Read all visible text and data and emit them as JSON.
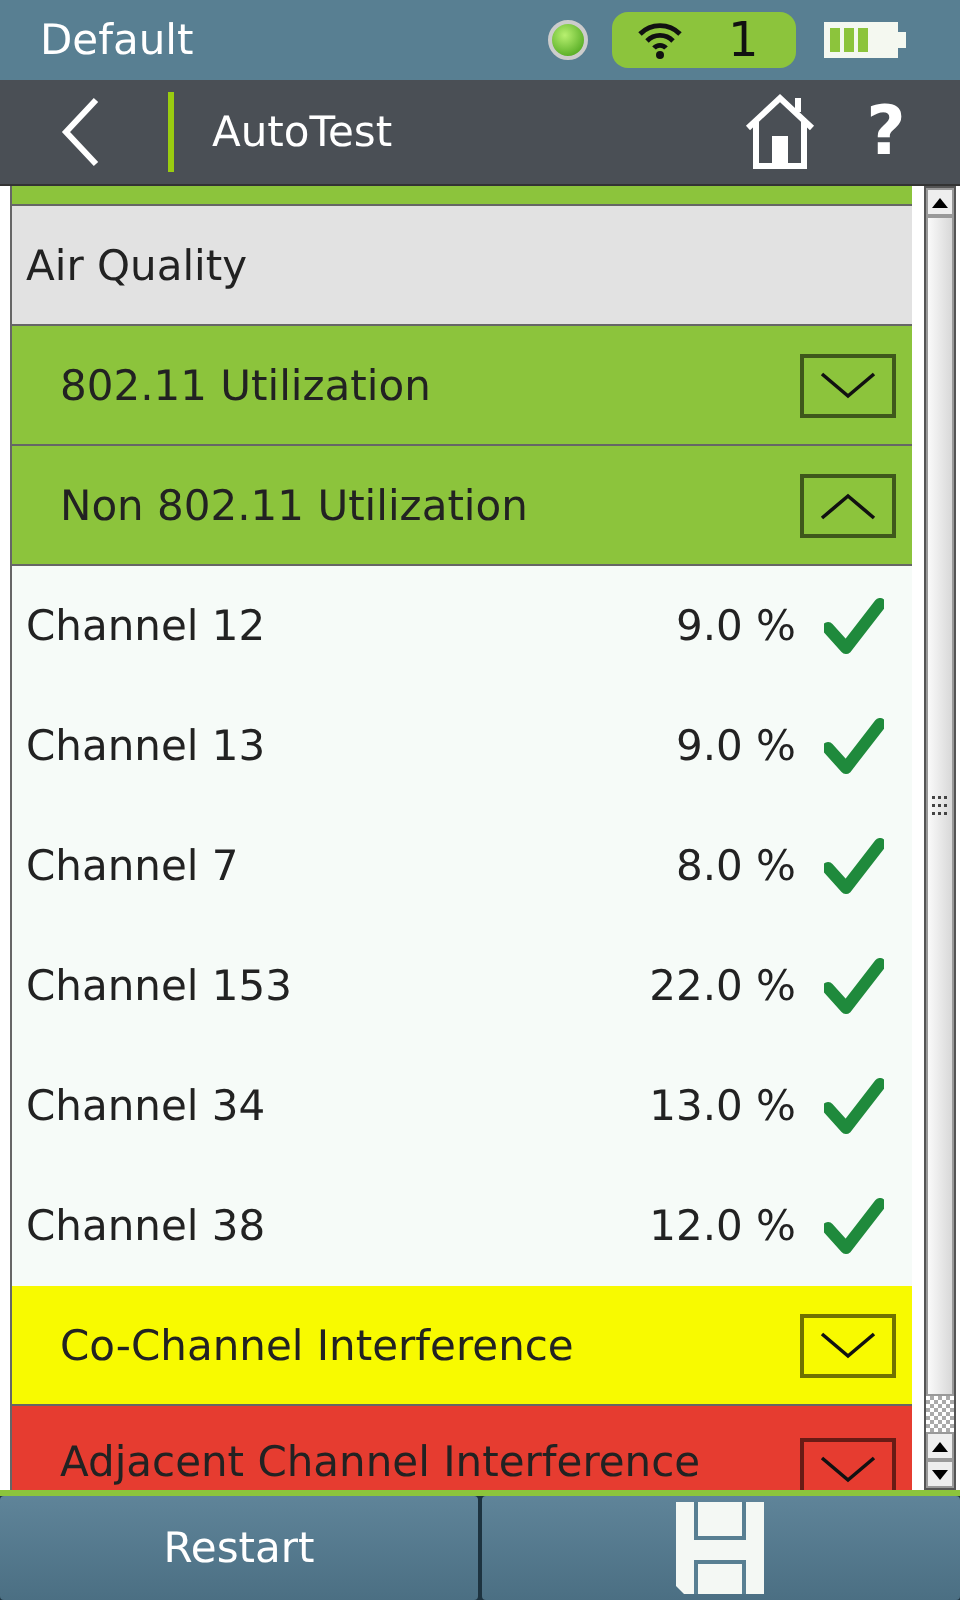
{
  "status_bar": {
    "profile": "Default",
    "wifi_count": "1"
  },
  "header": {
    "title": "AutoTest",
    "help": "?"
  },
  "list": {
    "rows": [
      {
        "kind": "strip",
        "color": "#8cc43c"
      },
      {
        "kind": "group",
        "label": "Air Quality"
      },
      {
        "kind": "section",
        "label": "802.11 Utilization",
        "color": "#8cc43c",
        "expanded": false
      },
      {
        "kind": "section",
        "label": "Non 802.11 Utilization",
        "color": "#8cc43c",
        "expanded": true
      },
      {
        "kind": "result",
        "label": "Channel 12",
        "value": "9.0 %",
        "passed": true
      },
      {
        "kind": "result",
        "label": "Channel 13",
        "value": "9.0 %",
        "passed": true
      },
      {
        "kind": "result",
        "label": "Channel 7",
        "value": "8.0 %",
        "passed": true
      },
      {
        "kind": "result",
        "label": "Channel 153",
        "value": "22.0 %",
        "passed": true
      },
      {
        "kind": "result",
        "label": "Channel 34",
        "value": "13.0 %",
        "passed": true
      },
      {
        "kind": "result",
        "label": "Channel 38",
        "value": "12.0 %",
        "passed": true
      },
      {
        "kind": "section",
        "label": "Co-Channel Interference",
        "color": "#f8fa00",
        "expanded": false
      },
      {
        "kind": "section",
        "label": "Adjacent Channel Interference",
        "color": "#e63c30",
        "expanded": false
      }
    ]
  },
  "footer": {
    "restart": "Restart"
  }
}
